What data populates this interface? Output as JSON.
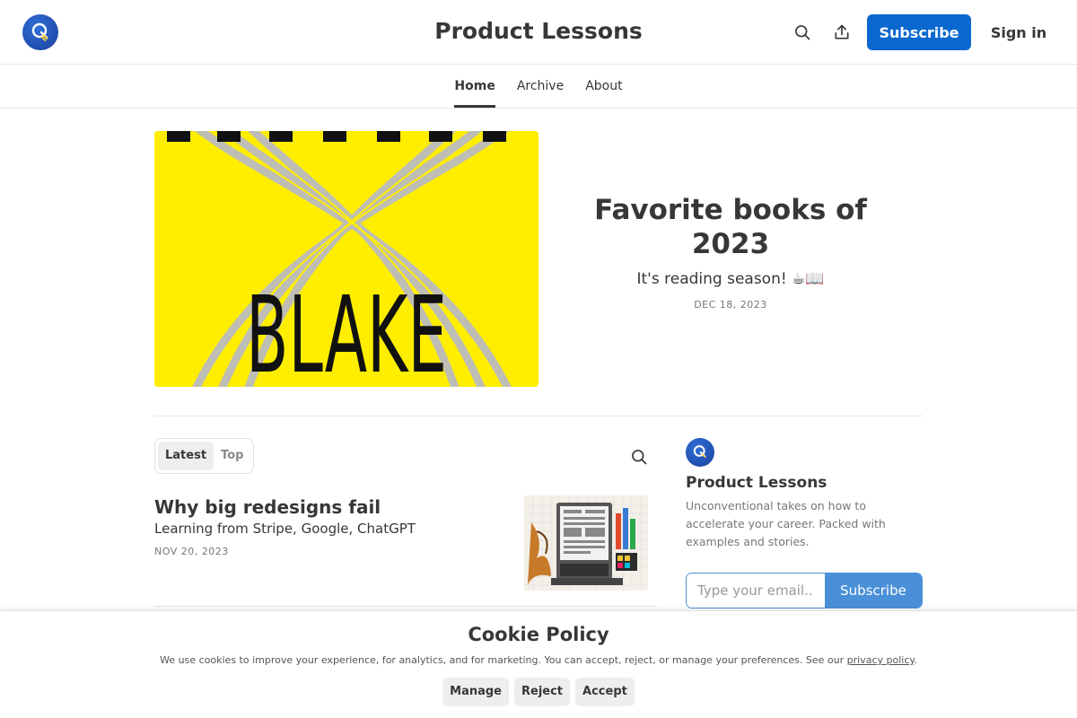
{
  "header": {
    "title": "Product Lessons",
    "subscribe_label": "Subscribe",
    "signin_label": "Sign in"
  },
  "nav": {
    "tabs": [
      {
        "label": "Home",
        "active": true
      },
      {
        "label": "Archive",
        "active": false
      },
      {
        "label": "About",
        "active": false
      }
    ]
  },
  "hero": {
    "title": "Favorite books of 2023",
    "subtitle": "It's reading season! ☕📖",
    "date": "DEC 18, 2023",
    "image_text": "BLAKE",
    "image_bg_color": "#ffee00"
  },
  "feed": {
    "tabs": [
      {
        "label": "Latest",
        "active": true
      },
      {
        "label": "Top",
        "active": false
      }
    ]
  },
  "posts": [
    {
      "title": "Why big redesigns fail",
      "subtitle": "Learning from Stripe, Google, ChatGPT",
      "date": "NOV 20, 2023"
    }
  ],
  "sidebar": {
    "title": "Product Lessons",
    "description": "Unconventional takes on how to accelerate your career. Packed with examples and stories.",
    "email_placeholder": "Type your email...",
    "subscribe_label": "Subscribe"
  },
  "cookie": {
    "title": "Cookie Policy",
    "text": "We use cookies to improve your experience, for analytics, and for marketing. You can accept, reject, or manage your preferences. See our",
    "link_label": "privacy policy",
    "text_end": ".",
    "buttons": {
      "manage": "Manage",
      "reject": "Reject",
      "accept": "Accept"
    }
  },
  "colors": {
    "accent": "#0b68cf",
    "sidebar_accent": "#4a90d9",
    "text": "#363737"
  },
  "icons": {
    "logo": "lightbulb-icon",
    "search": "search-icon",
    "share": "share-icon"
  }
}
